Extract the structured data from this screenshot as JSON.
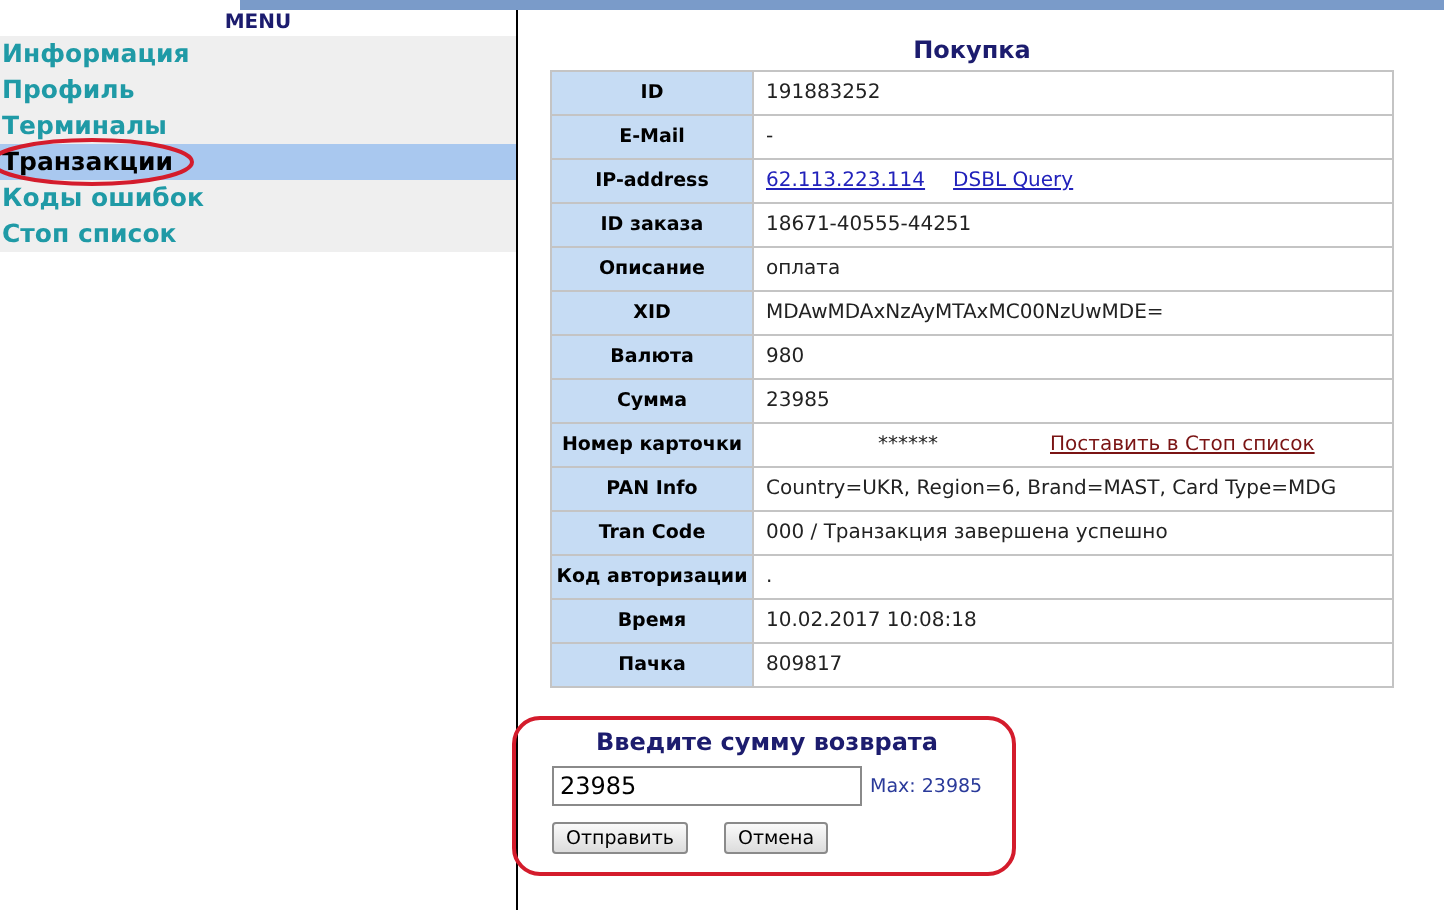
{
  "sidebar": {
    "title": "MENU",
    "items": [
      {
        "label": "Информация",
        "selected": false
      },
      {
        "label": "Профиль",
        "selected": false
      },
      {
        "label": "Терминалы",
        "selected": false
      },
      {
        "label": "Транзакции",
        "selected": true
      },
      {
        "label": "Коды ошибок",
        "selected": false
      },
      {
        "label": "Стоп список",
        "selected": false
      }
    ]
  },
  "purchase": {
    "title": "Покупка",
    "rows": [
      {
        "kind": "text",
        "label": "ID",
        "value": "191883252"
      },
      {
        "kind": "text",
        "label": "E-Mail",
        "value": "-"
      },
      {
        "kind": "links",
        "label": "IP-address",
        "links": [
          "62.113.223.114",
          "DSBL Query"
        ]
      },
      {
        "kind": "text",
        "label": "ID заказа",
        "value": "18671-40555-44251"
      },
      {
        "kind": "text",
        "label": "Описание",
        "value": "оплата"
      },
      {
        "kind": "text",
        "label": "XID",
        "value": "MDAwMDAxNzAyMTAxMC00NzUwMDE="
      },
      {
        "kind": "text",
        "label": "Валюта",
        "value": "980"
      },
      {
        "kind": "text",
        "label": "Сумма",
        "value": "23985"
      },
      {
        "kind": "masked",
        "label": "Номер карточки",
        "value": "******",
        "action": "Поставить в Стоп список"
      },
      {
        "kind": "text",
        "label": "PAN Info",
        "value": "Country=UKR, Region=6, Brand=MAST, Card Type=MDG"
      },
      {
        "kind": "text",
        "label": "Tran Code",
        "value": "000 / Транзакция завершена успешно"
      },
      {
        "kind": "text",
        "label": "Код авторизации",
        "value": "."
      },
      {
        "kind": "text",
        "label": "Время",
        "value": "10.02.2017 10:08:18"
      },
      {
        "kind": "text",
        "label": "Пачка",
        "value": "809817"
      }
    ]
  },
  "refund": {
    "title": "Введите сумму возврата",
    "amount": "23985",
    "max": "Max: 23985",
    "buttons": [
      "Отправить",
      "Отмена"
    ]
  }
}
